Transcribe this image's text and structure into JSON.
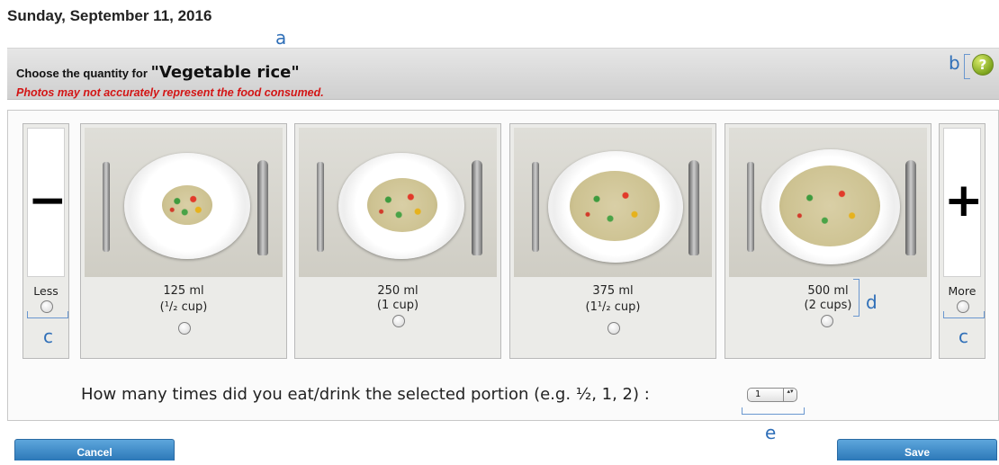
{
  "date": "Sunday, September 11, 2016",
  "header": {
    "choose_prefix": "Choose the quantity for ",
    "food_name": "\"Vegetable rice\"",
    "warning": "Photos may not accurately represent the food consumed.",
    "help_icon": "?"
  },
  "annotations": {
    "a": "a",
    "b": "b",
    "c_left": "c",
    "c_right": "c",
    "d": "d",
    "e": "e"
  },
  "portions": {
    "less": {
      "glyph": "−",
      "label": "Less"
    },
    "more": {
      "glyph": "+",
      "label": "More"
    },
    "items": [
      {
        "ml": "125 ml",
        "cup": "(¹/₂ cup)"
      },
      {
        "ml": "250 ml",
        "cup": "(1 cup)"
      },
      {
        "ml": "375 ml",
        "cup": "(1¹/₂ cup)"
      },
      {
        "ml": "500 ml",
        "cup": "(2 cups)"
      }
    ]
  },
  "question": "How many times did you eat/drink the selected portion (e.g. ½, 1, 2) :",
  "quantity": {
    "value": "1",
    "arrows": "▴▾"
  },
  "buttons": {
    "cancel": "Cancel",
    "save": "Save"
  },
  "colors": {
    "accent": "#2f6fb8",
    "warning": "#d31515",
    "button": "#3a86c6"
  }
}
